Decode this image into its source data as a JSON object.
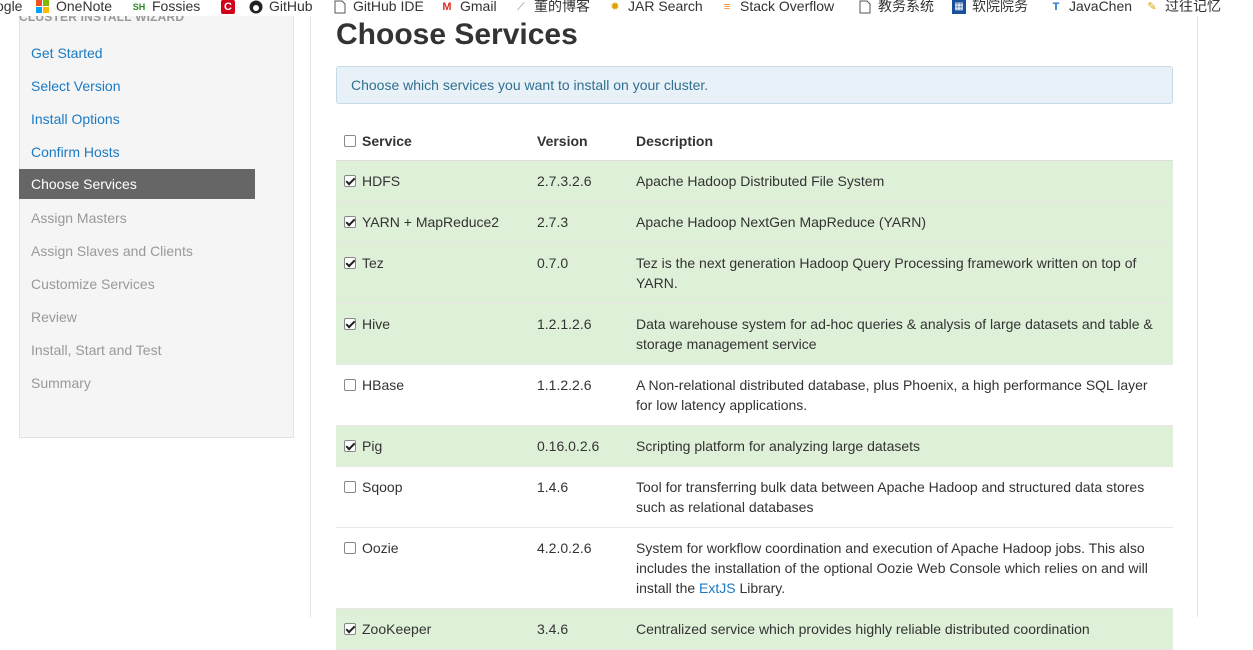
{
  "bookmarks": [
    {
      "label": "ogle",
      "icon": "google-icon"
    },
    {
      "label": "OneNote",
      "icon": "windows-icon"
    },
    {
      "label": "Fossies",
      "icon": "fossies-icon"
    },
    {
      "label": "",
      "icon": "c-icon"
    },
    {
      "label": "GitHub",
      "icon": "github-icon"
    },
    {
      "label": "GitHub IDE",
      "icon": "page-icon"
    },
    {
      "label": "Gmail",
      "icon": "gmail-icon"
    },
    {
      "label": "董的博客",
      "icon": "feather-icon"
    },
    {
      "label": "JAR Search",
      "icon": "jar-icon"
    },
    {
      "label": "Stack Overflow",
      "icon": "stackoverflow-icon"
    },
    {
      "label": "教务系统",
      "icon": "page-icon"
    },
    {
      "label": "软院院务",
      "icon": "grid-icon"
    },
    {
      "label": "JavaChen",
      "icon": "t-icon"
    },
    {
      "label": "过往记忆",
      "icon": "star-icon"
    }
  ],
  "sidebar": {
    "title": "CLUSTER INSTALL WIZARD",
    "steps": [
      {
        "label": "Get Started",
        "state": "link"
      },
      {
        "label": "Select Version",
        "state": "link"
      },
      {
        "label": "Install Options",
        "state": "link"
      },
      {
        "label": "Confirm Hosts",
        "state": "link"
      },
      {
        "label": "Choose Services",
        "state": "active"
      },
      {
        "label": "Assign Masters",
        "state": "disabled"
      },
      {
        "label": "Assign Slaves and Clients",
        "state": "disabled"
      },
      {
        "label": "Customize Services",
        "state": "disabled"
      },
      {
        "label": "Review",
        "state": "disabled"
      },
      {
        "label": "Install, Start and Test",
        "state": "disabled"
      },
      {
        "label": "Summary",
        "state": "disabled"
      }
    ]
  },
  "main": {
    "title": "Choose Services",
    "alert": "Choose which services you want to install on your cluster.",
    "columns": {
      "service": "Service",
      "version": "Version",
      "description": "Description"
    },
    "select_all_checked": false,
    "services": [
      {
        "name": "HDFS",
        "version": "2.7.3.2.6",
        "checked": true,
        "description": "Apache Hadoop Distributed File System"
      },
      {
        "name": "YARN + MapReduce2",
        "version": "2.7.3",
        "checked": true,
        "description": "Apache Hadoop NextGen MapReduce (YARN)"
      },
      {
        "name": "Tez",
        "version": "0.7.0",
        "checked": true,
        "description": "Tez is the next generation Hadoop Query Processing framework written on top of YARN."
      },
      {
        "name": "Hive",
        "version": "1.2.1.2.6",
        "checked": true,
        "description": "Data warehouse system for ad-hoc queries & analysis of large datasets and table & storage management service"
      },
      {
        "name": "HBase",
        "version": "1.1.2.2.6",
        "checked": false,
        "description": "A Non-relational distributed database, plus Phoenix, a high performance SQL layer for low latency applications."
      },
      {
        "name": "Pig",
        "version": "0.16.0.2.6",
        "checked": true,
        "description": "Scripting platform for analyzing large datasets"
      },
      {
        "name": "Sqoop",
        "version": "1.4.6",
        "checked": false,
        "description": "Tool for transferring bulk data between Apache Hadoop and structured data stores such as relational databases"
      },
      {
        "name": "Oozie",
        "version": "4.2.0.2.6",
        "checked": false,
        "description_before": "System for workflow coordination and execution of Apache Hadoop jobs. This also includes the installation of the optional Oozie Web Console which relies on and will install the ",
        "description_link": "ExtJS",
        "description_after": " Library."
      },
      {
        "name": "ZooKeeper",
        "version": "3.4.6",
        "checked": true,
        "description": "Centralized service which provides highly reliable distributed coordination"
      }
    ]
  }
}
